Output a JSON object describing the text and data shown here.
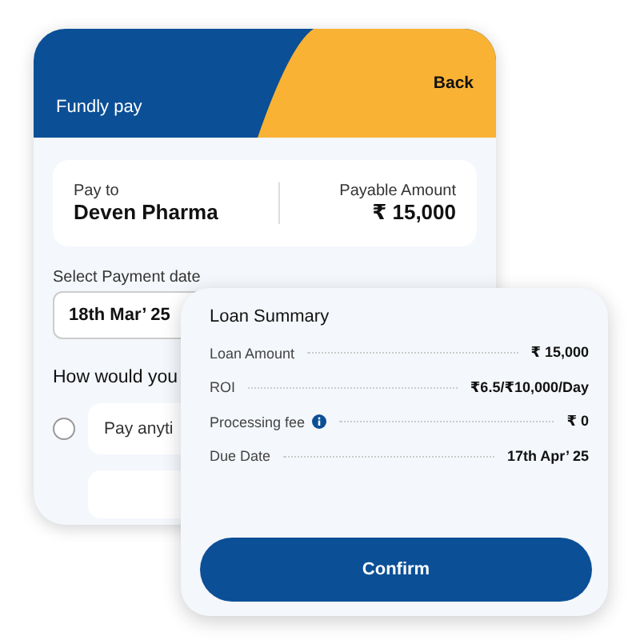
{
  "header": {
    "title": "Fundly pay",
    "back": "Back"
  },
  "payee": {
    "label": "Pay to",
    "name": "Deven Pharma",
    "amount_label": "Payable Amount",
    "amount": "₹ 15,000"
  },
  "payment_date": {
    "label": "Select Payment date",
    "value": "18th Mar’ 25"
  },
  "question": "How would you",
  "options": [
    {
      "label": "Pay anyti",
      "selected": false
    }
  ],
  "summary": {
    "title": "Loan Summary",
    "rows": [
      {
        "label": "Loan Amount",
        "value": "₹ 15,000",
        "info": false
      },
      {
        "label": "ROI",
        "value": "₹6.5/₹10,000/Day",
        "info": false
      },
      {
        "label": "Processing fee",
        "value": "₹ 0",
        "info": true
      },
      {
        "label": "Due Date",
        "value": "17th Apr’ 25",
        "info": false
      }
    ]
  },
  "confirm": "Confirm"
}
